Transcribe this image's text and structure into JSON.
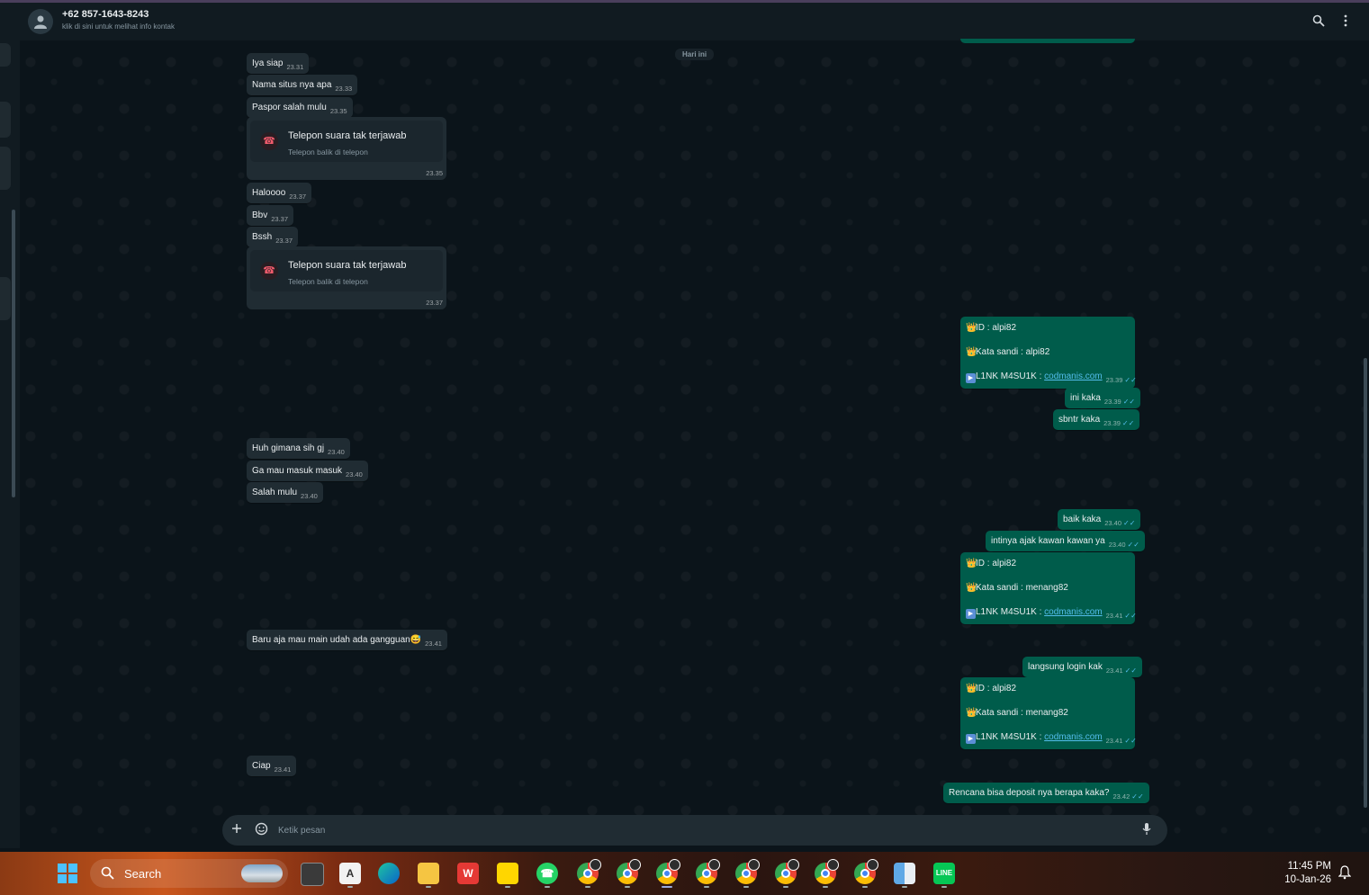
{
  "header": {
    "contact_name": "+62 857-1643-8243",
    "contact_subtitle": "klik di sini untuk melihat info kontak",
    "icons": [
      "avatar-icon",
      "search-icon",
      "menu-icon"
    ]
  },
  "date_divider": "Hari ini",
  "incoming": [
    {
      "text": "Iya siap",
      "time": "23.31"
    },
    {
      "text": "Nama situs nya apa",
      "time": "23.33"
    },
    {
      "text": "Paspor salah mulu",
      "time": "23.35"
    },
    {
      "text": "Haloooo",
      "time": "23.37"
    },
    {
      "text": "Bbv",
      "time": "23.37"
    },
    {
      "text": "Bssh",
      "time": "23.37"
    },
    {
      "text": "Huh gimana sih gj",
      "time": "23.40"
    },
    {
      "text": "Ga mau masuk masuk",
      "time": "23.40"
    },
    {
      "text": "Salah mulu",
      "time": "23.40"
    },
    {
      "text": "Baru aja mau main udah ada gangguan😅",
      "time": "23.41"
    },
    {
      "text": "Ciap",
      "time": "23.41"
    }
  ],
  "calls": [
    {
      "title": "Telepon suara tak terjawab",
      "subtitle": "Telepon balik di telepon",
      "time": "23.35"
    },
    {
      "title": "Telepon suara tak terjawab",
      "subtitle": "Telepon balik di telepon",
      "time": "23.37"
    }
  ],
  "outgoing": [
    {
      "text": "ini kaka",
      "time": "23.39"
    },
    {
      "text": "sbntr kaka",
      "time": "23.39"
    },
    {
      "text": "baik kaka",
      "time": "23.40"
    },
    {
      "text": "intinya ajak kawan kawan ya",
      "time": "23.40"
    },
    {
      "text": "langsung login kak",
      "time": "23.41"
    },
    {
      "text": "Rencana bisa deposit nya berapa kaka?",
      "time": "23.42"
    }
  ],
  "credentials": [
    {
      "id_line": "ID :  alpi82",
      "pass_line": "Kata sandi : alpi82",
      "link_label": "L1NK M4SU1K : ",
      "link": "codmanis.com",
      "time": "23.39"
    },
    {
      "id_line": "ID :  alpi82",
      "pass_line": "Kata sandi : menang82",
      "link_label": "L1NK M4SU1K : ",
      "link": "codmanis.com",
      "time": "23.41"
    },
    {
      "id_line": "ID :  alpi82",
      "pass_line": "Kata sandi : menang82",
      "link_label": "L1NK M4SU1K : ",
      "link": "codmanis.com",
      "time": "23.41"
    }
  ],
  "composer": {
    "placeholder": "Ketik pesan"
  },
  "taskbar": {
    "search_label": "Search",
    "time": "11:45 PM",
    "date": "10-Jan-26",
    "apps": [
      "task-view-icon",
      "a-app-icon",
      "edge-icon",
      "file-explorer-icon",
      "wps-icon",
      "sticky-notes-icon",
      "whatsapp-icon",
      "chrome-icon",
      "chrome-icon",
      "chrome-icon",
      "chrome-icon",
      "chrome-icon",
      "chrome-icon",
      "chrome-icon",
      "chrome-icon",
      "finder-icon",
      "line-icon"
    ]
  },
  "colors": {
    "incoming_bubble": "#202c33",
    "outgoing_bubble": "#005c4b",
    "background": "#0b141a",
    "link": "#53bdeb"
  }
}
